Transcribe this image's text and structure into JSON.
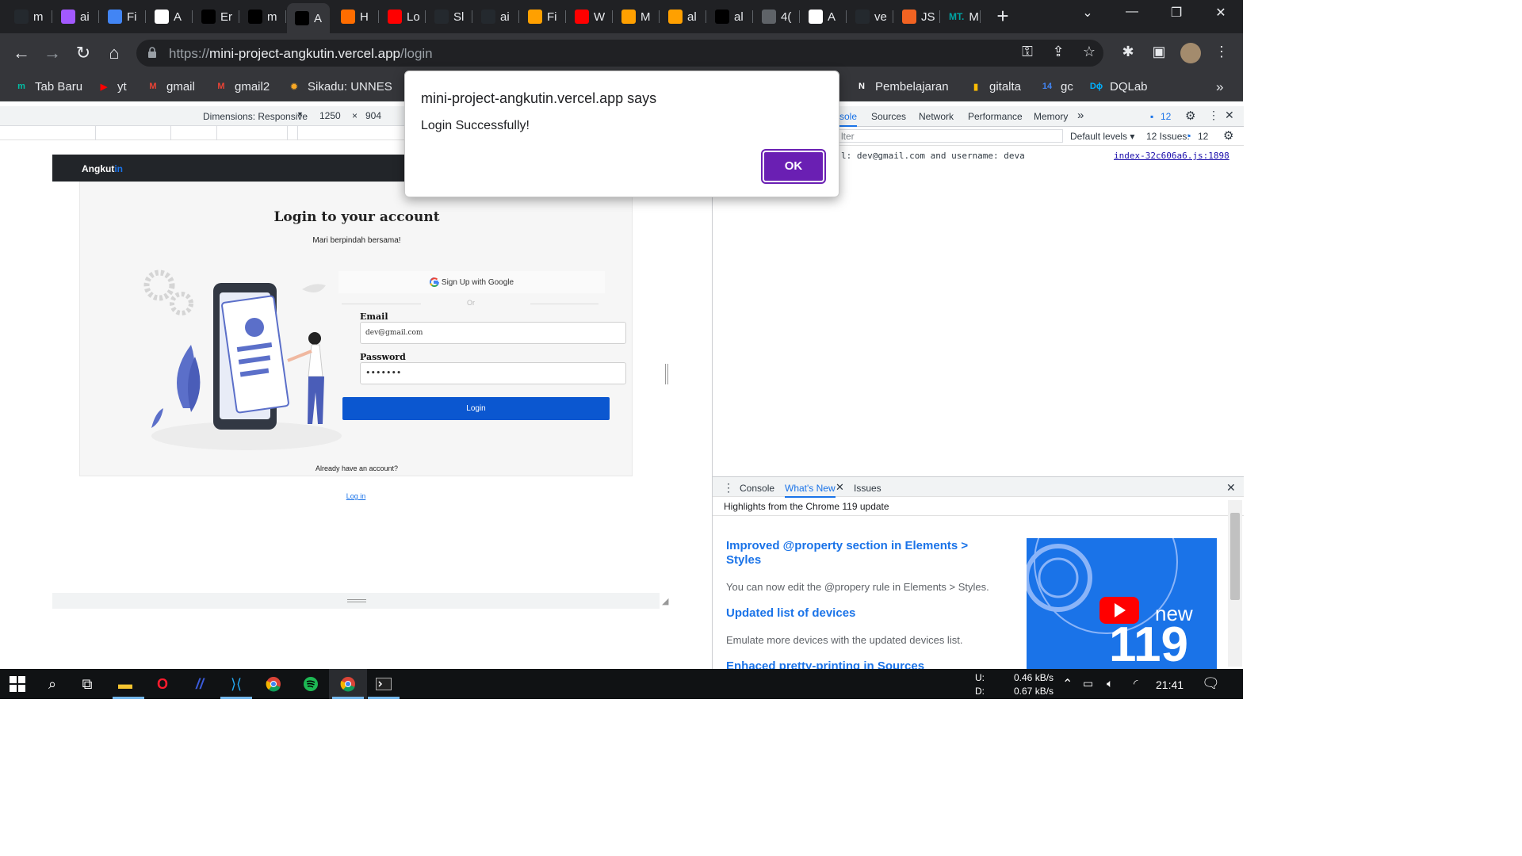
{
  "tabs": [
    {
      "label": "m",
      "color": "#24292e"
    },
    {
      "label": "ai",
      "color": "#a259ff"
    },
    {
      "label": "Fi",
      "color": "#4285f4"
    },
    {
      "label": "A",
      "color": "#ffffff"
    },
    {
      "label": "Er",
      "color": "#000000"
    },
    {
      "label": "m",
      "color": "#000000"
    },
    {
      "label": "A",
      "color": "#000000",
      "active": true
    },
    {
      "label": "H",
      "color": "#ff6d00"
    },
    {
      "label": "Lo",
      "color": "#ff0000"
    },
    {
      "label": "Sl",
      "color": "#24292e"
    },
    {
      "label": "ai",
      "color": "#24292e"
    },
    {
      "label": "Fi",
      "color": "#ffa000"
    },
    {
      "label": "W",
      "color": "#ff0000"
    },
    {
      "label": "M",
      "color": "#ffa000"
    },
    {
      "label": "al",
      "color": "#ffa000"
    },
    {
      "label": "al",
      "color": "#000000"
    },
    {
      "label": "4(",
      "color": "#5f6368"
    },
    {
      "label": "A",
      "color": "#ffffff"
    },
    {
      "label": "ve",
      "color": "#24292e"
    },
    {
      "label": "JS",
      "color": "#f26322"
    },
    {
      "label": "M",
      "color": "#00a3a3",
      "prefix": "MT."
    }
  ],
  "address": {
    "scheme": "https://",
    "host": "mini-project-angkutin.vercel.app",
    "path": "/login"
  },
  "bookmarks": [
    {
      "label": "Tab Baru",
      "icon": "m",
      "color": "#00bfa5"
    },
    {
      "label": "yt",
      "icon": "▶",
      "color": "#ff0000"
    },
    {
      "label": "gmail",
      "icon": "M",
      "color": "#ea4335"
    },
    {
      "label": "gmail2",
      "icon": "M",
      "color": "#ea4335"
    },
    {
      "label": "Sikadu: UNNES",
      "icon": "✹",
      "color": "#f9a825"
    },
    {
      "label": "Pembelajaran",
      "icon": "N",
      "color": "#ffffff"
    },
    {
      "label": "gitalta",
      "icon": "▮",
      "color": "#fbbc04"
    },
    {
      "label": "gc",
      "icon": "14",
      "color": "#4285f4"
    },
    {
      "label": "DQLab",
      "icon": "Dϕ",
      "color": "#00b0ff"
    }
  ],
  "device_toolbar": {
    "dimensions": "Dimensions: Responsive",
    "width": "1250",
    "times": "×",
    "height": "904"
  },
  "page": {
    "brand": "Angkut",
    "brand_accent": "in",
    "title": "Login to your account",
    "subtitle": "Mari berpindah bersama!",
    "google_button": "Sign Up with Google",
    "or": "Or",
    "email_label": "Email",
    "email_value": "dev@gmail.com",
    "password_label": "Password",
    "password_value": "•••••••",
    "login_button": "Login",
    "already": "Already have an account?",
    "login_link": "Log in"
  },
  "dialog": {
    "title": "mini-project-angkutin.vercel.app says",
    "message": "Login Successfully!",
    "ok": "OK"
  },
  "devtools": {
    "tabs": [
      "sole",
      "Sources",
      "Network",
      "Performance",
      "Memory"
    ],
    "more": "»",
    "issues_count": "12",
    "filter_placeholder": "lter",
    "default_levels": "Default levels ▾",
    "issues_label": "12 Issues:",
    "issues_num": "12",
    "console_message": "l: dev@gmail.com and username: deva",
    "console_source": "index-32c606a6.js:1898",
    "drawer_tabs": [
      "Console",
      "What's New",
      "Issues"
    ],
    "drawer_subtitle": "Highlights from the Chrome 119 update",
    "whats_new": [
      {
        "title": "Improved @property section in Elements > Styles",
        "desc": "You can now edit the @propery rule in Elements > Styles."
      },
      {
        "title": "Updated list of devices",
        "desc": "Emulate more devices with the updated devices list."
      },
      {
        "title": "Enhaced pretty-printing in Sources",
        "desc": ""
      }
    ],
    "promo_new": "new",
    "promo_version": "119"
  },
  "taskbar": {
    "network_up_label": "U:",
    "network_down_label": "D:",
    "network_up": "0.46 kB/s",
    "network_down": "0.67 kB/s",
    "time": "21:41"
  }
}
